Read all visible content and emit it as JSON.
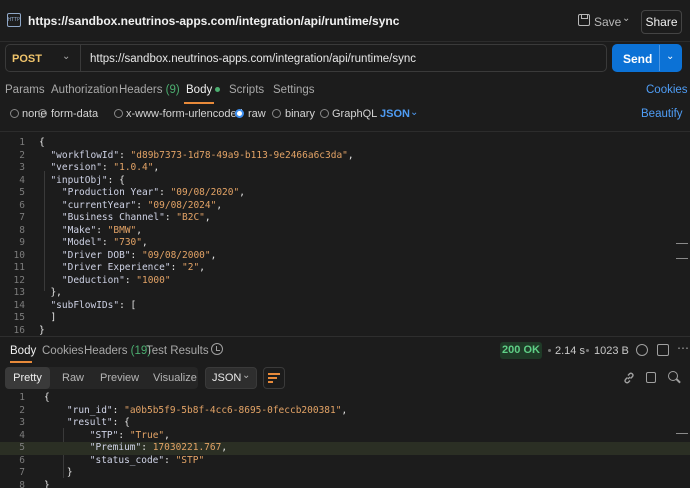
{
  "window": {
    "app_icon_text": "HTTP",
    "title": "https://sandbox.neutrinos-apps.com/integration/api/runtime/sync",
    "save_label": "Save",
    "share_label": "Share"
  },
  "request": {
    "method": "POST",
    "url": "https://sandbox.neutrinos-apps.com/integration/api/runtime/sync",
    "send_label": "Send",
    "tabs": [
      {
        "label": "Params"
      },
      {
        "label": "Authorization"
      },
      {
        "label": "Headers",
        "count": "(9)"
      },
      {
        "label": "Body",
        "active": true
      },
      {
        "label": "Scripts"
      },
      {
        "label": "Settings"
      }
    ],
    "cookies_label": "Cookies",
    "beautify_label": "Beautify",
    "body_types": [
      "none",
      "form-data",
      "x-www-form-urlencoded",
      "raw",
      "binary",
      "GraphQL"
    ],
    "body_type_selected": "raw",
    "format": "JSON"
  },
  "request_body_lines": [
    {
      "n": "1",
      "text": "{"
    },
    {
      "n": "2",
      "text": "  \"workflowId\": \"d89b7373-1d78-49a9-b113-9e2466a6c3da\","
    },
    {
      "n": "3",
      "text": "  \"version\": \"1.0.4\","
    },
    {
      "n": "4",
      "text": "  \"inputObj\": {"
    },
    {
      "n": "5",
      "text": "    \"Production Year\": \"09/08/2020\","
    },
    {
      "n": "6",
      "text": "    \"currentYear\": \"09/08/2024\","
    },
    {
      "n": "7",
      "text": "    \"Business Channel\": \"B2C\","
    },
    {
      "n": "8",
      "text": "    \"Make\": \"BMW\","
    },
    {
      "n": "9",
      "text": "    \"Model\": \"730\","
    },
    {
      "n": "10",
      "text": "    \"Driver DOB\": \"09/08/2000\","
    },
    {
      "n": "11",
      "text": "    \"Driver Experience\": \"2\","
    },
    {
      "n": "12",
      "text": "    \"Deduction\": \"1000\""
    },
    {
      "n": "13",
      "text": "  },"
    },
    {
      "n": "14",
      "text": "  \"subFlowIDs\": ["
    },
    {
      "n": "15",
      "text": "  ]"
    },
    {
      "n": "16",
      "text": "}"
    }
  ],
  "response": {
    "tabs": [
      {
        "label": "Body",
        "active": true
      },
      {
        "label": "Cookies"
      },
      {
        "label": "Headers",
        "count": "(19)"
      },
      {
        "label": "Test Results"
      }
    ],
    "status": "200 OK",
    "time": "2.14 s",
    "size": "1023 B",
    "view_modes": [
      "Pretty",
      "Raw",
      "Preview",
      "Visualize"
    ],
    "view_mode_selected": "Pretty",
    "format": "JSON"
  },
  "response_body_lines": [
    {
      "n": "1",
      "text": "{"
    },
    {
      "n": "2",
      "text": "    \"run_id\": \"a0b5b5f9-5b8f-4cc6-8695-0feccb200381\","
    },
    {
      "n": "3",
      "text": "    \"result\": {"
    },
    {
      "n": "4",
      "text": "        \"STP\": \"True\","
    },
    {
      "n": "5",
      "text": "        \"Premium\": 17030221.767,"
    },
    {
      "n": "6",
      "text": "        \"status_code\": \"STP\""
    },
    {
      "n": "7",
      "text": "    }"
    },
    {
      "n": "8",
      "text": "}"
    }
  ],
  "colors": {
    "accent_blue": "#0c72d6",
    "method_yellow": "#f0c46b",
    "status_green": "#5fcf86",
    "tab_underline": "#e88a3a",
    "string_orange": "#e3a366"
  }
}
